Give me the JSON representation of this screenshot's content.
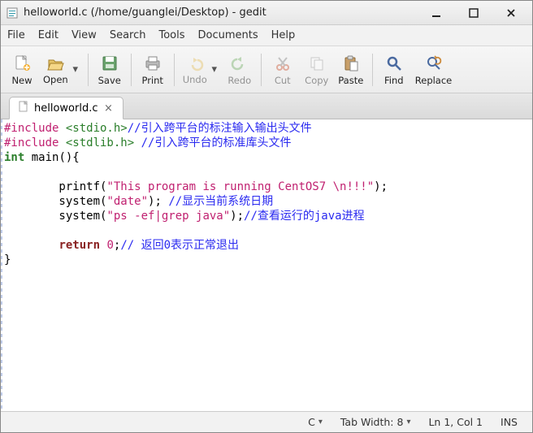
{
  "window": {
    "title": "helloworld.c (/home/guanglei/Desktop) - gedit"
  },
  "menu": {
    "items": [
      "File",
      "Edit",
      "View",
      "Search",
      "Tools",
      "Documents",
      "Help"
    ]
  },
  "toolbar": {
    "new": "New",
    "open": "Open",
    "save": "Save",
    "print": "Print",
    "undo": "Undo",
    "redo": "Redo",
    "cut": "Cut",
    "copy": "Copy",
    "paste": "Paste",
    "find": "Find",
    "replace": "Replace"
  },
  "tab": {
    "label": "helloworld.c"
  },
  "code": {
    "l1_preproc": "#include ",
    "l1_hdr": "<stdio.h>",
    "l1_cmt": "//引入跨平台的标注输入输出头文件",
    "l2_preproc": "#include ",
    "l2_hdr": "<stdlib.h>",
    "l2_sp": " ",
    "l2_cmt": "//引入跨平台的标准库头文件",
    "l3_kw": "int",
    "l3_rest": " main(){",
    "blank": "",
    "l5_indent": "        printf(",
    "l5_str": "\"This program is running CentOS7 \\n!!!\"",
    "l5_end": ");",
    "l6_indent": "        system(",
    "l6_str": "\"date\"",
    "l6_end": "); ",
    "l6_cmt": "//显示当前系统日期",
    "l7_indent": "        system(",
    "l7_str": "\"ps -ef|grep java\"",
    "l7_end": ");",
    "l7_cmt": "//查看运行的java进程",
    "l9_indent": "        ",
    "l9_kw": "return",
    "l9_sp": " ",
    "l9_num": "0",
    "l9_end": ";",
    "l9_cmt": "// 返回0表示正常退出",
    "l10": "}"
  },
  "status": {
    "lang": "C",
    "tabwidth": "Tab Width: 8",
    "pos": "Ln 1, Col 1",
    "mode": "INS"
  }
}
